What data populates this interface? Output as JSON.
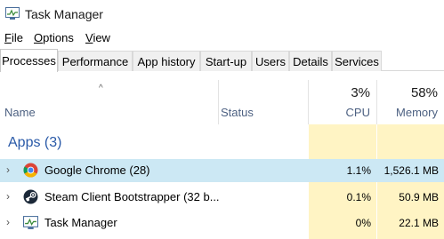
{
  "window": {
    "title": "Task Manager",
    "icon": "task-manager-icon"
  },
  "menu": {
    "items": [
      {
        "label": "File",
        "accel": "F",
        "rest": "ile"
      },
      {
        "label": "Options",
        "accel": "O",
        "rest": "ptions"
      },
      {
        "label": "View",
        "accel": "V",
        "rest": "iew"
      }
    ]
  },
  "tabs": [
    {
      "label": "Processes",
      "active": true
    },
    {
      "label": "Performance",
      "active": false
    },
    {
      "label": "App history",
      "active": false
    },
    {
      "label": "Start-up",
      "active": false
    },
    {
      "label": "Users",
      "active": false
    },
    {
      "label": "Details",
      "active": false
    },
    {
      "label": "Services",
      "active": false
    }
  ],
  "columns": {
    "name": "Name",
    "status": "Status",
    "cpu": {
      "label": "CPU",
      "total": "3%"
    },
    "memory": {
      "label": "Memory",
      "total": "58%"
    },
    "sort_indicator": "^"
  },
  "groups": [
    {
      "label": "Apps (3)",
      "rows": [
        {
          "name": "Google Chrome (28)",
          "icon": "chrome-icon",
          "cpu": "1.1%",
          "memory": "1,526.1 MB",
          "selected": true
        },
        {
          "name": "Steam Client Bootstrapper (32 b...",
          "icon": "steam-icon",
          "cpu": "0.1%",
          "memory": "50.9 MB",
          "selected": false
        },
        {
          "name": "Task Manager",
          "icon": "task-manager-icon",
          "cpu": "0%",
          "memory": "22.1 MB",
          "selected": false
        }
      ]
    }
  ],
  "colors": {
    "usage_tint": "#fff4c4",
    "selection": "#cce8f4",
    "group_label": "#2a5aa8",
    "header_label": "#4d6182"
  }
}
